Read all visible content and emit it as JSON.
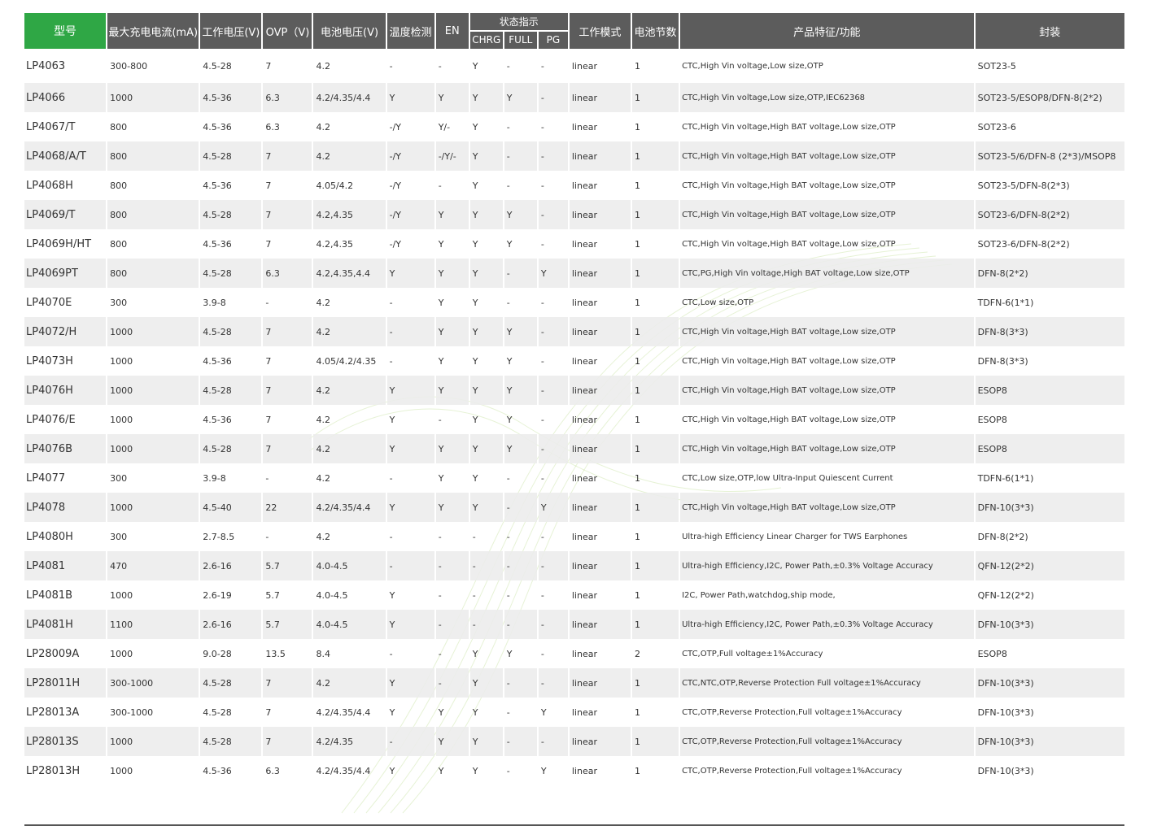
{
  "headers": {
    "model": "型号",
    "max_current": "最大充电电流(mA)",
    "vin": "工作电压(V)",
    "ovp": "OVP（V)",
    "vbat": "电池电压(V)",
    "temp": "温度检测",
    "en": "EN",
    "status": "状态指示",
    "chrg": "CHRG",
    "full": "FULL",
    "pg": "PG",
    "mode": "工作模式",
    "cells": "电池节数",
    "features": "产品特征/功能",
    "package": "封装"
  },
  "colors": {
    "header_bg": "#5c5c5c",
    "first_header_bg": "#2fa745",
    "row_shade": "#ececec",
    "wave": "#8dc63f"
  },
  "rows": [
    [
      "LP4063",
      "300-800",
      "4.5-28",
      "7",
      "4.2",
      "-",
      "-",
      "Y",
      "-",
      "-",
      "linear",
      "1",
      "CTC,High Vin voltage,Low size,OTP",
      "SOT23-5"
    ],
    [
      "LP4066",
      "1000",
      "4.5-36",
      "6.3",
      "4.2/4.35/4.4",
      "Y",
      "Y",
      "Y",
      "Y",
      "-",
      "linear",
      "1",
      "CTC,High Vin voltage,Low size,OTP,IEC62368",
      "SOT23-5/ESOP8/DFN-8(2*2)"
    ],
    [
      "LP4067/T",
      "800",
      "4.5-36",
      "6.3",
      "4.2",
      "-/Y",
      "Y/-",
      "Y",
      "-",
      "-",
      "linear",
      "1",
      "CTC,High Vin voltage,High BAT voltage,Low size,OTP",
      "SOT23-6"
    ],
    [
      "LP4068/A/T",
      "800",
      "4.5-28",
      "7",
      "4.2",
      "-/Y",
      "-/Y/-",
      "Y",
      "-",
      "-",
      "linear",
      "1",
      "CTC,High Vin voltage,High BAT voltage,Low size,OTP",
      "SOT23-5/6/DFN-8 (2*3)/MSOP8"
    ],
    [
      "LP4068H",
      "800",
      "4.5-36",
      "7",
      "4.05/4.2",
      "-/Y",
      "-",
      "Y",
      "-",
      "-",
      "linear",
      "1",
      "CTC,High Vin voltage,High BAT voltage,Low size,OTP",
      "SOT23-5/DFN-8(2*3)"
    ],
    [
      "LP4069/T",
      "800",
      "4.5-28",
      "7",
      "4.2,4.35",
      "-/Y",
      "Y",
      "Y",
      "Y",
      "-",
      "linear",
      "1",
      "CTC,High Vin voltage,High BAT voltage,Low size,OTP",
      "SOT23-6/DFN-8(2*2)"
    ],
    [
      "LP4069H/HT",
      "800",
      "4.5-36",
      "7",
      "4.2,4.35",
      "-/Y",
      "Y",
      "Y",
      "Y",
      "-",
      "linear",
      "1",
      "CTC,High Vin voltage,High BAT voltage,Low size,OTP",
      "SOT23-6/DFN-8(2*2)"
    ],
    [
      "LP4069PT",
      "800",
      "4.5-28",
      "6.3",
      "4.2,4.35,4.4",
      "Y",
      "Y",
      "Y",
      "-",
      "Y",
      "linear",
      "1",
      "CTC,PG,High Vin voltage,High BAT voltage,Low size,OTP",
      "DFN-8(2*2)"
    ],
    [
      "LP4070E",
      "300",
      "3.9-8",
      "-",
      "4.2",
      "-",
      "Y",
      "Y",
      "-",
      "-",
      "linear",
      "1",
      "CTC,Low size,OTP",
      "TDFN-6(1*1)"
    ],
    [
      "LP4072/H",
      "1000",
      "4.5-28",
      "7",
      "4.2",
      "-",
      "Y",
      "Y",
      "Y",
      "-",
      "linear",
      "1",
      "CTC,High Vin voltage,High BAT voltage,Low size,OTP",
      "DFN-8(3*3)"
    ],
    [
      "LP4073H",
      "1000",
      "4.5-36",
      "7",
      "4.05/4.2/4.35",
      "-",
      "Y",
      "Y",
      "Y",
      "-",
      "linear",
      "1",
      "CTC,High Vin voltage,High BAT voltage,Low size,OTP",
      "DFN-8(3*3)"
    ],
    [
      "LP4076H",
      "1000",
      "4.5-28",
      "7",
      "4.2",
      "Y",
      "Y",
      "Y",
      "Y",
      "-",
      "linear",
      "1",
      "CTC,High Vin voltage,High BAT voltage,Low size,OTP",
      "ESOP8"
    ],
    [
      "LP4076/E",
      "1000",
      "4.5-36",
      "7",
      "4.2",
      "Y",
      "-",
      "Y",
      "Y",
      "-",
      "linear",
      "1",
      "CTC,High Vin voltage,High BAT voltage,Low size,OTP",
      "ESOP8"
    ],
    [
      "LP4076B",
      "1000",
      "4.5-28",
      "7",
      "4.2",
      "Y",
      "Y",
      "Y",
      "Y",
      "-",
      "linear",
      "1",
      "CTC,High Vin voltage,High BAT voltage,Low size,OTP",
      "ESOP8"
    ],
    [
      "LP4077",
      "300",
      "3.9-8",
      "-",
      "4.2",
      "-",
      "Y",
      "Y",
      "-",
      "-",
      "linear",
      "1",
      "CTC,Low size,OTP,low Ultra-Input Quiescent Current",
      "TDFN-6(1*1)"
    ],
    [
      "LP4078",
      "1000",
      "4.5-40",
      "22",
      "4.2/4.35/4.4",
      "Y",
      "Y",
      "Y",
      "-",
      "Y",
      "linear",
      "1",
      "CTC,High Vin voltage,High BAT voltage,Low size,OTP",
      "DFN-10(3*3)"
    ],
    [
      "LP4080H",
      "300",
      "2.7-8.5",
      "-",
      "4.2",
      "-",
      "-",
      "-",
      "-",
      "-",
      "linear",
      "1",
      "Ultra-high Efficiency Linear Charger for TWS Earphones",
      "DFN-8(2*2)"
    ],
    [
      "LP4081",
      "470",
      "2.6-16",
      "5.7",
      "4.0-4.5",
      "-",
      "-",
      "-",
      "-",
      "-",
      "linear",
      "1",
      "Ultra-high Efficiency,I2C, Power Path,±0.3% Voltage Accuracy",
      "QFN-12(2*2)"
    ],
    [
      "LP4081B",
      "1000",
      "2.6-19",
      "5.7",
      "4.0-4.5",
      "Y",
      "-",
      "-",
      "-",
      "-",
      "linear",
      "1",
      "I2C, Power Path,watchdog,ship mode,",
      "QFN-12(2*2)"
    ],
    [
      "LP4081H",
      "1100",
      "2.6-16",
      "5.7",
      "4.0-4.5",
      "Y",
      "-",
      "-",
      "-",
      "-",
      "linear",
      "1",
      "Ultra-high Efficiency,I2C, Power Path,±0.3% Voltage Accuracy",
      "DFN-10(3*3)"
    ],
    [
      "LP28009A",
      "1000",
      "9.0-28",
      "13.5",
      "8.4",
      "-",
      "-",
      "Y",
      "Y",
      "-",
      "linear",
      "2",
      "CTC,OTP,Full voltage±1%Accuracy",
      "ESOP8"
    ],
    [
      "LP28011H",
      "300-1000",
      "4.5-28",
      "7",
      "4.2",
      "Y",
      "-",
      "Y",
      "-",
      "-",
      "linear",
      "1",
      "CTC,NTC,OTP,Reverse Protection    Full voltage±1%Accuracy",
      "DFN-10(3*3)"
    ],
    [
      "LP28013A",
      "300-1000",
      "4.5-28",
      "7",
      "4.2/4.35/4.4",
      "Y",
      "Y",
      "Y",
      "-",
      "Y",
      "linear",
      "1",
      "CTC,OTP,Reverse Protection,Full voltage±1%Accuracy",
      "DFN-10(3*3)"
    ],
    [
      "LP28013S",
      "1000",
      "4.5-28",
      "7",
      "4.2/4.35",
      "-",
      "Y",
      "Y",
      "-",
      "-",
      "linear",
      "1",
      "CTC,OTP,Reverse Protection,Full voltage±1%Accuracy",
      "DFN-10(3*3)"
    ],
    [
      "LP28013H",
      "1000",
      "4.5-36",
      "6.3",
      "4.2/4.35/4.4",
      "Y",
      "Y",
      "Y",
      "-",
      "Y",
      "linear",
      "1",
      "CTC,OTP,Reverse Protection,Full voltage±1%Accuracy",
      "DFN-10(3*3)"
    ]
  ]
}
